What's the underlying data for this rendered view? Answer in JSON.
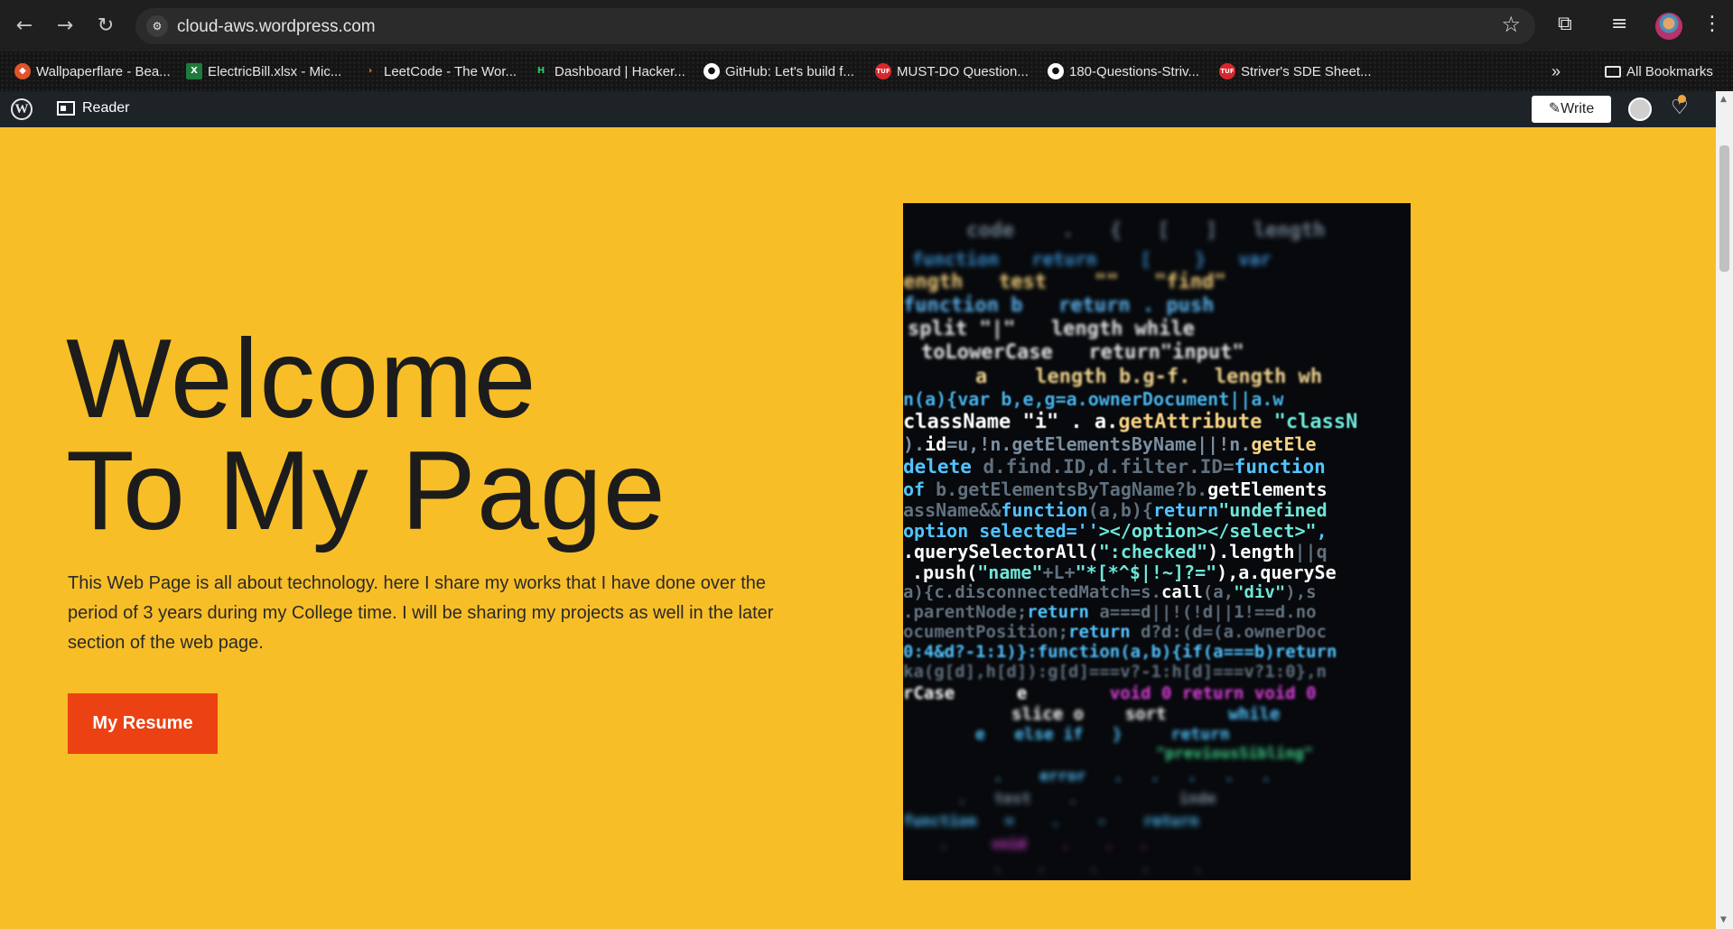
{
  "browser": {
    "url": "cloud-aws.wordpress.com",
    "bookmarks": [
      {
        "label": "Wallpaperflare - Bea...",
        "icon": "flame-icon",
        "color": "#e0532a"
      },
      {
        "label": "ElectricBill.xlsx - Mic...",
        "icon": "excel-icon",
        "color": "#1f7a3c"
      },
      {
        "label": "LeetCode - The Wor...",
        "icon": "leetcode-icon",
        "color": "#f4a21f"
      },
      {
        "label": "Dashboard | Hacker...",
        "icon": "hackerrank-icon",
        "color": "#2ec866"
      },
      {
        "label": "GitHub: Let's build f...",
        "icon": "github-icon",
        "color": "#ffffff"
      },
      {
        "label": "MUST-DO Question...",
        "icon": "tuf-icon",
        "color": "#d9262c"
      },
      {
        "label": "180-Questions-Striv...",
        "icon": "github-icon",
        "color": "#ffffff"
      },
      {
        "label": "Striver's SDE Sheet...",
        "icon": "tuf-icon",
        "color": "#d9262c"
      }
    ],
    "all_bookmarks": "All Bookmarks"
  },
  "wp_bar": {
    "reader": "Reader",
    "write": "Write"
  },
  "hero": {
    "title_line1": "Welcome",
    "title_line2": "To My Page",
    "description": "This Web Page is all about technology. here I share my works that I have done over the period of 3 years during my College time. I will be sharing my projects as well in the later section of the web page.",
    "button": "My Resume",
    "background": "#f8be27",
    "button_color": "#ec4112"
  }
}
